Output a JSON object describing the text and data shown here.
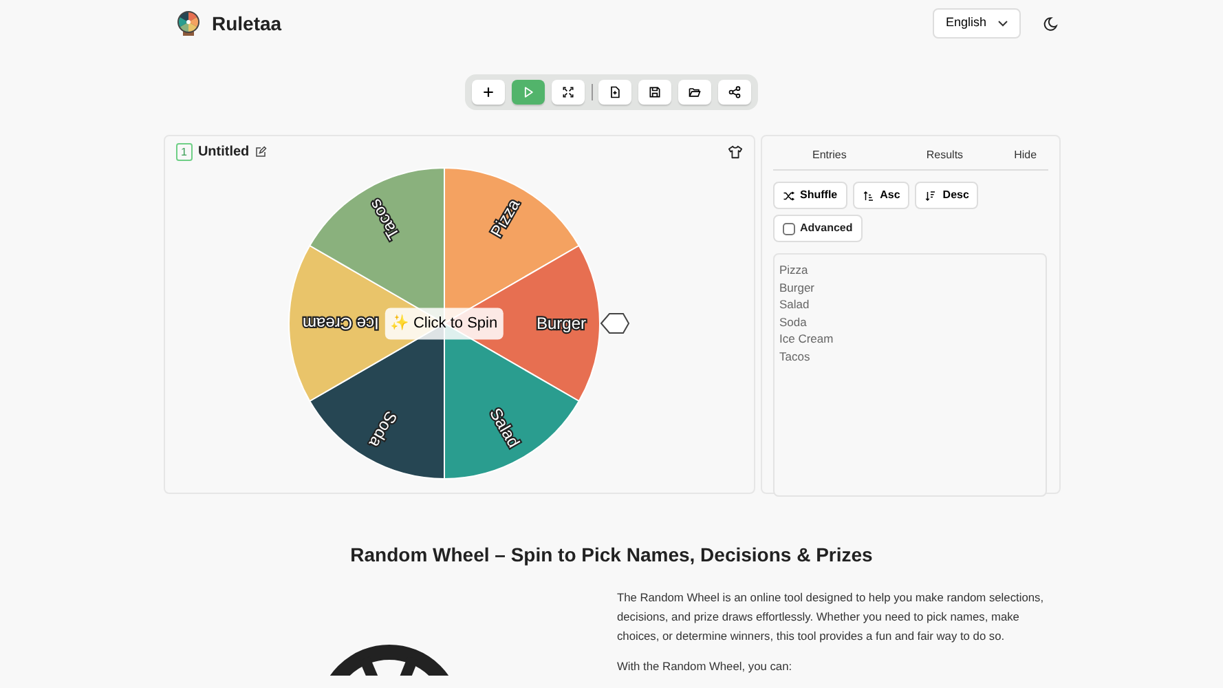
{
  "header": {
    "brand": "Ruletaa",
    "language": "English"
  },
  "toolbar": [
    {
      "kind": "add",
      "selected": false
    },
    {
      "kind": "play",
      "selected": true
    },
    {
      "kind": "fullscreen",
      "selected": false
    },
    {
      "kind": "new-file",
      "selected": false
    },
    {
      "kind": "save",
      "selected": false
    },
    {
      "kind": "open",
      "selected": false
    },
    {
      "kind": "share",
      "selected": false
    }
  ],
  "wheel_card": {
    "number": "1",
    "title": "Untitled",
    "spin_button": "✨ Click to Spin",
    "segments": [
      {
        "label": "Pizza",
        "color": "#f4a261"
      },
      {
        "label": "Burger",
        "color": "#e76f51"
      },
      {
        "label": "Salad",
        "color": "#2a9d8f"
      },
      {
        "label": "Soda",
        "color": "#264653"
      },
      {
        "label": "Ice Cream",
        "color": "#e9c46a"
      },
      {
        "label": "Tacos",
        "color": "#8ab17d"
      }
    ]
  },
  "side_panel": {
    "tabs": [
      "Entries",
      "Results"
    ],
    "hide": "Hide",
    "actions": [
      {
        "kind": "shuffle",
        "label": "Shuffle"
      },
      {
        "kind": "asc",
        "label": "Asc"
      },
      {
        "kind": "desc",
        "label": "Desc"
      }
    ],
    "advanced": {
      "label": "Advanced",
      "checked": false
    },
    "entries": [
      "Pizza",
      "Burger",
      "Salad",
      "Soda",
      "Ice Cream",
      "Tacos"
    ]
  },
  "article": {
    "heading": "Random Wheel – Spin to Pick Names, Decisions & Prizes",
    "paragraphs": [
      "The Random Wheel is an online tool designed to help you make random selections, decisions, and prize draws effortlessly. Whether you need to pick names, make choices, or determine winners, this tool provides a fun and fair way to do so.",
      "With the Random Wheel, you can:"
    ]
  }
}
